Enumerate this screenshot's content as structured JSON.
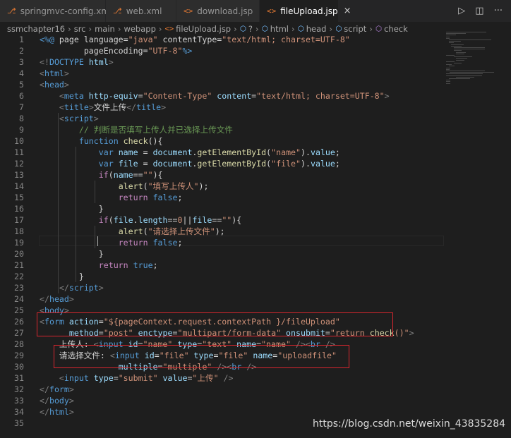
{
  "tabs": [
    {
      "icon": "rss-icon",
      "label": "springmvc-config.xml",
      "active": false
    },
    {
      "icon": "rss-icon",
      "label": "web.xml",
      "active": false
    },
    {
      "icon": "code-icon",
      "label": "download.jsp",
      "active": false
    },
    {
      "icon": "code-icon",
      "label": "fileUpload.jsp",
      "active": true,
      "close": "×"
    }
  ],
  "tab_actions": {
    "run": "▷",
    "split": "◫",
    "more": "···"
  },
  "breadcrumb": {
    "items": [
      "ssmchapter16",
      "src",
      "main",
      "webapp"
    ],
    "file_icon": "<>",
    "file": "fileUpload.jsp",
    "q": "?",
    "html": "html",
    "head": "head",
    "script": "script",
    "check": "check",
    "sep": "›"
  },
  "code": {
    "lines": [
      [
        [
          "kw",
          "<%@ "
        ],
        [
          "txt",
          "page language="
        ],
        [
          "str",
          "\"java\""
        ],
        [
          "txt",
          " contentType="
        ],
        [
          "str",
          "\"text/html; charset=UTF-8\""
        ]
      ],
      [
        [
          "txt",
          "         pageEncoding="
        ],
        [
          "str",
          "\"UTF-8\""
        ],
        [
          "kw",
          "%>"
        ]
      ],
      [
        [
          "pun",
          "<!"
        ],
        [
          "tag",
          "DOCTYPE"
        ],
        [
          "attr",
          " html"
        ],
        [
          "pun",
          ">"
        ]
      ],
      [
        [
          "pun",
          "<"
        ],
        [
          "tag",
          "html"
        ],
        [
          "pun",
          ">"
        ]
      ],
      [
        [
          "pun",
          "<"
        ],
        [
          "tag",
          "head"
        ],
        [
          "pun",
          ">"
        ]
      ],
      [
        [
          "txt",
          "    "
        ],
        [
          "pun",
          "<"
        ],
        [
          "tag",
          "meta"
        ],
        [
          "attr",
          " http-equiv"
        ],
        [
          "txt",
          "="
        ],
        [
          "str",
          "\"Content-Type\""
        ],
        [
          "attr",
          " content"
        ],
        [
          "txt",
          "="
        ],
        [
          "str",
          "\"text/html; charset=UTF-8\""
        ],
        [
          "pun",
          ">"
        ]
      ],
      [
        [
          "txt",
          "    "
        ],
        [
          "pun",
          "<"
        ],
        [
          "tag",
          "title"
        ],
        [
          "pun",
          ">"
        ],
        [
          "txt",
          "文件上传"
        ],
        [
          "pun",
          "</"
        ],
        [
          "tag",
          "title"
        ],
        [
          "pun",
          ">"
        ]
      ],
      [
        [
          "txt",
          "    "
        ],
        [
          "pun",
          "<"
        ],
        [
          "tag",
          "script"
        ],
        [
          "pun",
          ">"
        ]
      ],
      [
        [
          "txt",
          "        "
        ],
        [
          "cmt",
          "// 判断是否填写上传人并已选择上传文件"
        ]
      ],
      [
        [
          "txt",
          "        "
        ],
        [
          "kw",
          "function"
        ],
        [
          "txt",
          " "
        ],
        [
          "fn",
          "check"
        ],
        [
          "txt",
          "(){"
        ]
      ],
      [
        [
          "txt",
          "            "
        ],
        [
          "kw",
          "var"
        ],
        [
          "txt",
          " "
        ],
        [
          "var",
          "name"
        ],
        [
          "txt",
          " = "
        ],
        [
          "var",
          "document"
        ],
        [
          "txt",
          "."
        ],
        [
          "fn",
          "getElementById"
        ],
        [
          "txt",
          "("
        ],
        [
          "str",
          "\"name\""
        ],
        [
          "txt",
          ")."
        ],
        [
          "var",
          "value"
        ],
        [
          "txt",
          ";"
        ]
      ],
      [
        [
          "txt",
          "            "
        ],
        [
          "kw",
          "var"
        ],
        [
          "txt",
          " "
        ],
        [
          "var",
          "file"
        ],
        [
          "txt",
          " = "
        ],
        [
          "var",
          "document"
        ],
        [
          "txt",
          "."
        ],
        [
          "fn",
          "getElementById"
        ],
        [
          "txt",
          "("
        ],
        [
          "str",
          "\"file\""
        ],
        [
          "txt",
          ")."
        ],
        [
          "var",
          "value"
        ],
        [
          "txt",
          ";"
        ]
      ],
      [
        [
          "txt",
          "            "
        ],
        [
          "ctl",
          "if"
        ],
        [
          "txt",
          "("
        ],
        [
          "var",
          "name"
        ],
        [
          "txt",
          "=="
        ],
        [
          "str",
          "\"\""
        ],
        [
          "txt",
          "){"
        ]
      ],
      [
        [
          "txt",
          "                "
        ],
        [
          "fn",
          "alert"
        ],
        [
          "txt",
          "("
        ],
        [
          "str",
          "\"填写上传人\""
        ],
        [
          "txt",
          ");"
        ]
      ],
      [
        [
          "txt",
          "                "
        ],
        [
          "ctl",
          "return"
        ],
        [
          "txt",
          " "
        ],
        [
          "kw",
          "false"
        ],
        [
          "txt",
          ";"
        ]
      ],
      [
        [
          "txt",
          "            }"
        ]
      ],
      [
        [
          "txt",
          "            "
        ],
        [
          "ctl",
          "if"
        ],
        [
          "txt",
          "("
        ],
        [
          "var",
          "file"
        ],
        [
          "txt",
          "."
        ],
        [
          "var",
          "length"
        ],
        [
          "txt",
          "=="
        ],
        [
          "str",
          "0"
        ],
        [
          "txt",
          "||"
        ],
        [
          "var",
          "file"
        ],
        [
          "txt",
          "=="
        ],
        [
          "str",
          "\"\""
        ],
        [
          "txt",
          "){"
        ]
      ],
      [
        [
          "txt",
          "                "
        ],
        [
          "fn",
          "alert"
        ],
        [
          "txt",
          "("
        ],
        [
          "str",
          "\"请选择上传文件\""
        ],
        [
          "txt",
          ");"
        ]
      ],
      [
        [
          "txt",
          "                "
        ],
        [
          "ctl",
          "return"
        ],
        [
          "txt",
          " "
        ],
        [
          "kw",
          "false"
        ],
        [
          "txt",
          ";"
        ]
      ],
      [
        [
          "txt",
          "            }"
        ]
      ],
      [
        [
          "txt",
          "            "
        ],
        [
          "ctl",
          "return"
        ],
        [
          "txt",
          " "
        ],
        [
          "kw",
          "true"
        ],
        [
          "txt",
          ";"
        ]
      ],
      [
        [
          "txt",
          "        }"
        ]
      ],
      [
        [
          "txt",
          "    "
        ],
        [
          "pun",
          "</"
        ],
        [
          "tag",
          "script"
        ],
        [
          "pun",
          ">"
        ]
      ],
      [
        [
          "pun",
          "</"
        ],
        [
          "tag",
          "head"
        ],
        [
          "pun",
          ">"
        ]
      ],
      [
        [
          "pun",
          "<"
        ],
        [
          "tag",
          "body"
        ],
        [
          "pun",
          ">"
        ]
      ],
      [
        [
          "pun",
          "<"
        ],
        [
          "tag",
          "form"
        ],
        [
          "attr",
          " action"
        ],
        [
          "txt",
          "="
        ],
        [
          "str",
          "\"${pageContext.request.contextPath }/fileUpload\""
        ]
      ],
      [
        [
          "txt",
          "      "
        ],
        [
          "attr",
          "method"
        ],
        [
          "txt",
          "="
        ],
        [
          "str",
          "\"post\""
        ],
        [
          "attr",
          " enctype"
        ],
        [
          "txt",
          "="
        ],
        [
          "str",
          "\"multipart/form-data\""
        ],
        [
          "attr",
          " onsubmit"
        ],
        [
          "txt",
          "="
        ],
        [
          "str",
          "\"return "
        ],
        [
          "fn",
          "check"
        ],
        [
          "str",
          "()\""
        ],
        [
          "pun",
          ">"
        ]
      ],
      [
        [
          "txt",
          "    上传人: "
        ],
        [
          "pun",
          "<"
        ],
        [
          "tag",
          "input"
        ],
        [
          "attr",
          " id"
        ],
        [
          "txt",
          "="
        ],
        [
          "str",
          "\"name\""
        ],
        [
          "attr",
          " type"
        ],
        [
          "txt",
          "="
        ],
        [
          "str",
          "\"text\""
        ],
        [
          "attr",
          " name"
        ],
        [
          "txt",
          "="
        ],
        [
          "str",
          "\"name\""
        ],
        [
          "pun",
          " /><"
        ],
        [
          "tag",
          "br"
        ],
        [
          "pun",
          " />"
        ]
      ],
      [
        [
          "txt",
          "    请选择文件: "
        ],
        [
          "pun",
          "<"
        ],
        [
          "tag",
          "input"
        ],
        [
          "attr",
          " id"
        ],
        [
          "txt",
          "="
        ],
        [
          "str",
          "\"file\""
        ],
        [
          "attr",
          " type"
        ],
        [
          "txt",
          "="
        ],
        [
          "str",
          "\"file\""
        ],
        [
          "attr",
          " name"
        ],
        [
          "txt",
          "="
        ],
        [
          "str",
          "\"uploadfile\""
        ]
      ],
      [
        [
          "txt",
          "                "
        ],
        [
          "attr",
          "multiple"
        ],
        [
          "txt",
          "="
        ],
        [
          "str",
          "\"multiple\""
        ],
        [
          "pun",
          " /><"
        ],
        [
          "tag",
          "br"
        ],
        [
          "pun",
          " />"
        ]
      ],
      [
        [
          "txt",
          "    "
        ],
        [
          "pun",
          "<"
        ],
        [
          "tag",
          "input"
        ],
        [
          "attr",
          " type"
        ],
        [
          "txt",
          "="
        ],
        [
          "str",
          "\"submit\""
        ],
        [
          "attr",
          " value"
        ],
        [
          "txt",
          "="
        ],
        [
          "str",
          "\"上传\""
        ],
        [
          "pun",
          " />"
        ]
      ],
      [
        [
          "pun",
          "</"
        ],
        [
          "tag",
          "form"
        ],
        [
          "pun",
          ">"
        ]
      ],
      [
        [
          "pun",
          "</"
        ],
        [
          "tag",
          "body"
        ],
        [
          "pun",
          ">"
        ]
      ],
      [
        [
          "pun",
          "</"
        ],
        [
          "tag",
          "html"
        ],
        [
          "pun",
          ">"
        ]
      ],
      []
    ]
  },
  "colors": {
    "background": "#1e1e1e",
    "highlight_box": "#d8262e",
    "tab_active": "#1e1e1e",
    "tab_inactive": "#2d2d2d"
  },
  "watermark": "https://blog.csdn.net/weixin_43835284"
}
